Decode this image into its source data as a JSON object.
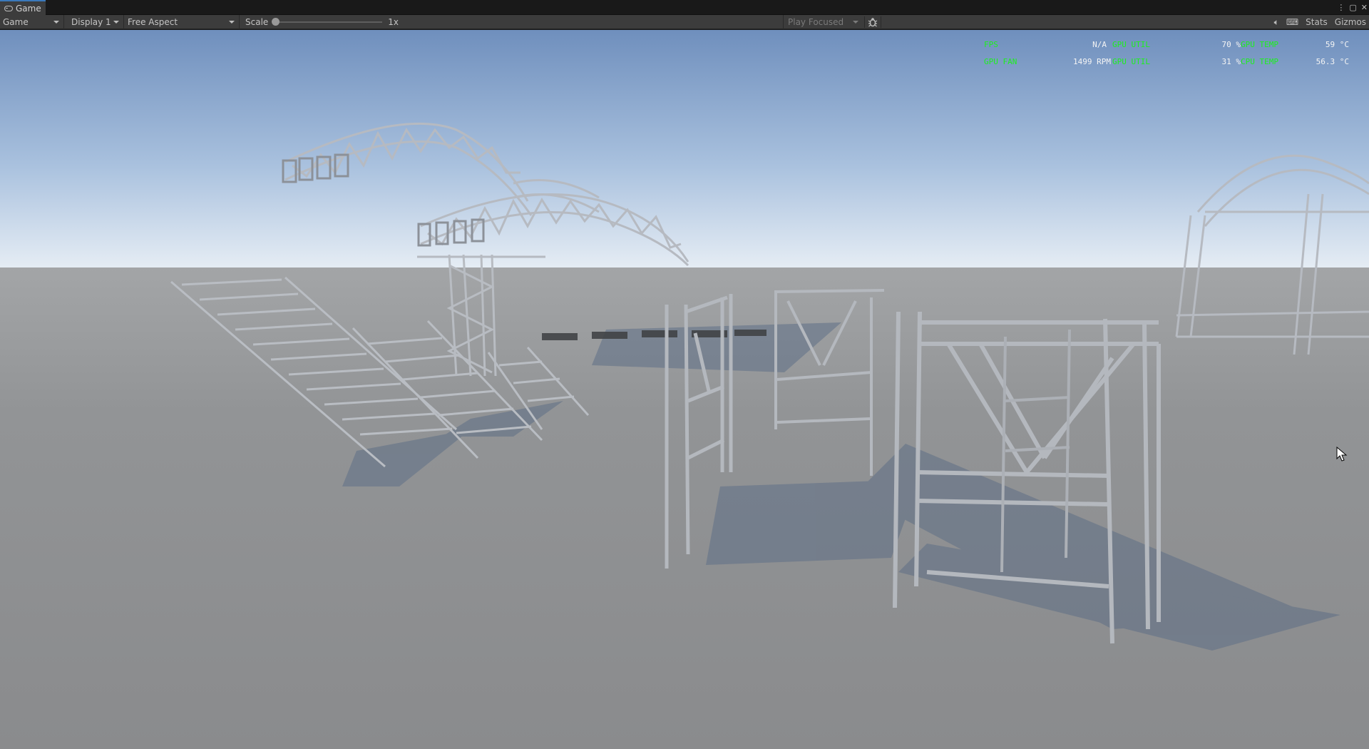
{
  "tab": {
    "title": "Game"
  },
  "toolbar": {
    "view_mode": "Game",
    "display": "Display 1",
    "aspect": "Free Aspect",
    "scale_label": "Scale",
    "scale_value": "1x",
    "play_mode": "Play Focused",
    "stats_label": "Stats",
    "gizmos_label": "Gizmos"
  },
  "hud": {
    "fps_label": "FPS",
    "fps_value": "N/A",
    "gpu_util_label_1": "GPU UTIL",
    "gpu_util_value_1": "70 %",
    "gpu_temp_label_1": "GPU TEMP",
    "gpu_temp_value_1": "59 °C",
    "gpu_fan_label": "GPU FAN",
    "gpu_fan_value": "1499 RPM",
    "gpu_util_label_2": "GPU UTIL",
    "gpu_util_value_2": "31 %",
    "gpu_temp_label_2": "CPU TEMP",
    "gpu_temp_value_2": "56.3 °C"
  },
  "colors": {
    "hud_label": "#1df01d",
    "toolbar_bg": "#3c3c3c",
    "tab_accent": "#3a79bb",
    "sky_top": "#6f8fbd",
    "sky_horizon": "#e7eef6",
    "ground": "#8a8c8e",
    "truss": "#b8bcc2"
  },
  "icons": {
    "tab": "game-controller-icon",
    "bug": "bug-icon",
    "audio": "speaker-icon",
    "keyboard": "keyboard-icon",
    "menu": "kebab-menu-icon",
    "maximize": "maximize-icon",
    "close": "close-icon",
    "cursor": "mouse-cursor-icon"
  }
}
